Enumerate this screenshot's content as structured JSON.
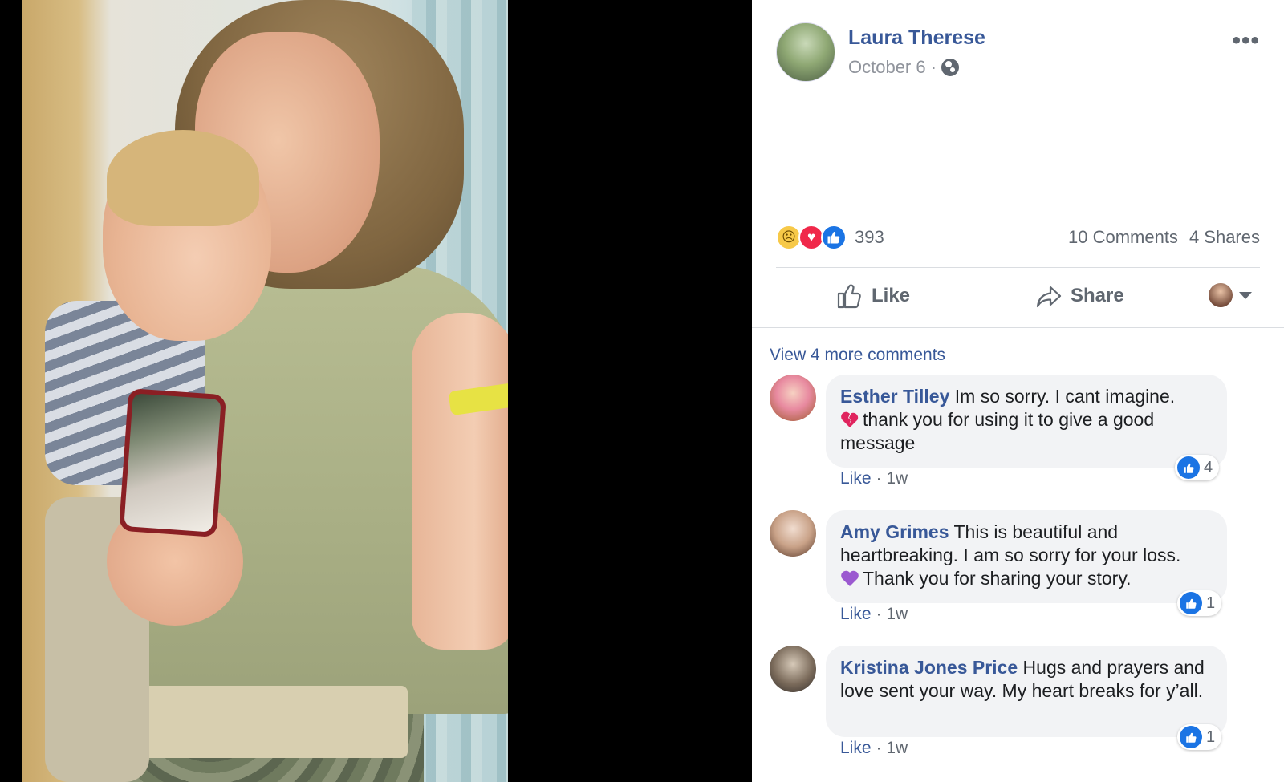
{
  "post": {
    "author": "Laura Therese",
    "date": "October 6 ·",
    "privacy_icon": "globe-icon",
    "more_label": "•••"
  },
  "reactions": {
    "count": "393",
    "comments": "10 Comments",
    "shares": "4 Shares",
    "types": [
      "sad",
      "love",
      "like"
    ]
  },
  "actions": {
    "like_label": "Like",
    "share_label": "Share"
  },
  "comments": {
    "view_more": "View 4 more comments",
    "items": [
      {
        "name": "Esther Tilley",
        "text_before": "Im so sorry. I cant imagine.",
        "emoji": "broken-heart",
        "text_after": "thank you for using it to give a good message",
        "like": "Like",
        "time": "· 1w",
        "reaction_count": "4"
      },
      {
        "name": "Amy Grimes",
        "text_before": "This is beautiful and heartbreaking. I am so sorry for your loss.",
        "emoji": "purple-heart",
        "text_after": "Thank you for sharing your story.",
        "like": "Like",
        "time": "· 1w",
        "reaction_count": "1"
      },
      {
        "name": "Kristina Jones Price",
        "text_before": "Hugs and prayers and love sent your way. My heart breaks for y’all.",
        "emoji": "",
        "text_after": "",
        "like": "Like",
        "time": "· 1w",
        "reaction_count": "1"
      }
    ]
  },
  "colors": {
    "link_blue": "#385898",
    "like_blue": "#1b74e4",
    "bubble_gray": "#f2f3f5"
  }
}
